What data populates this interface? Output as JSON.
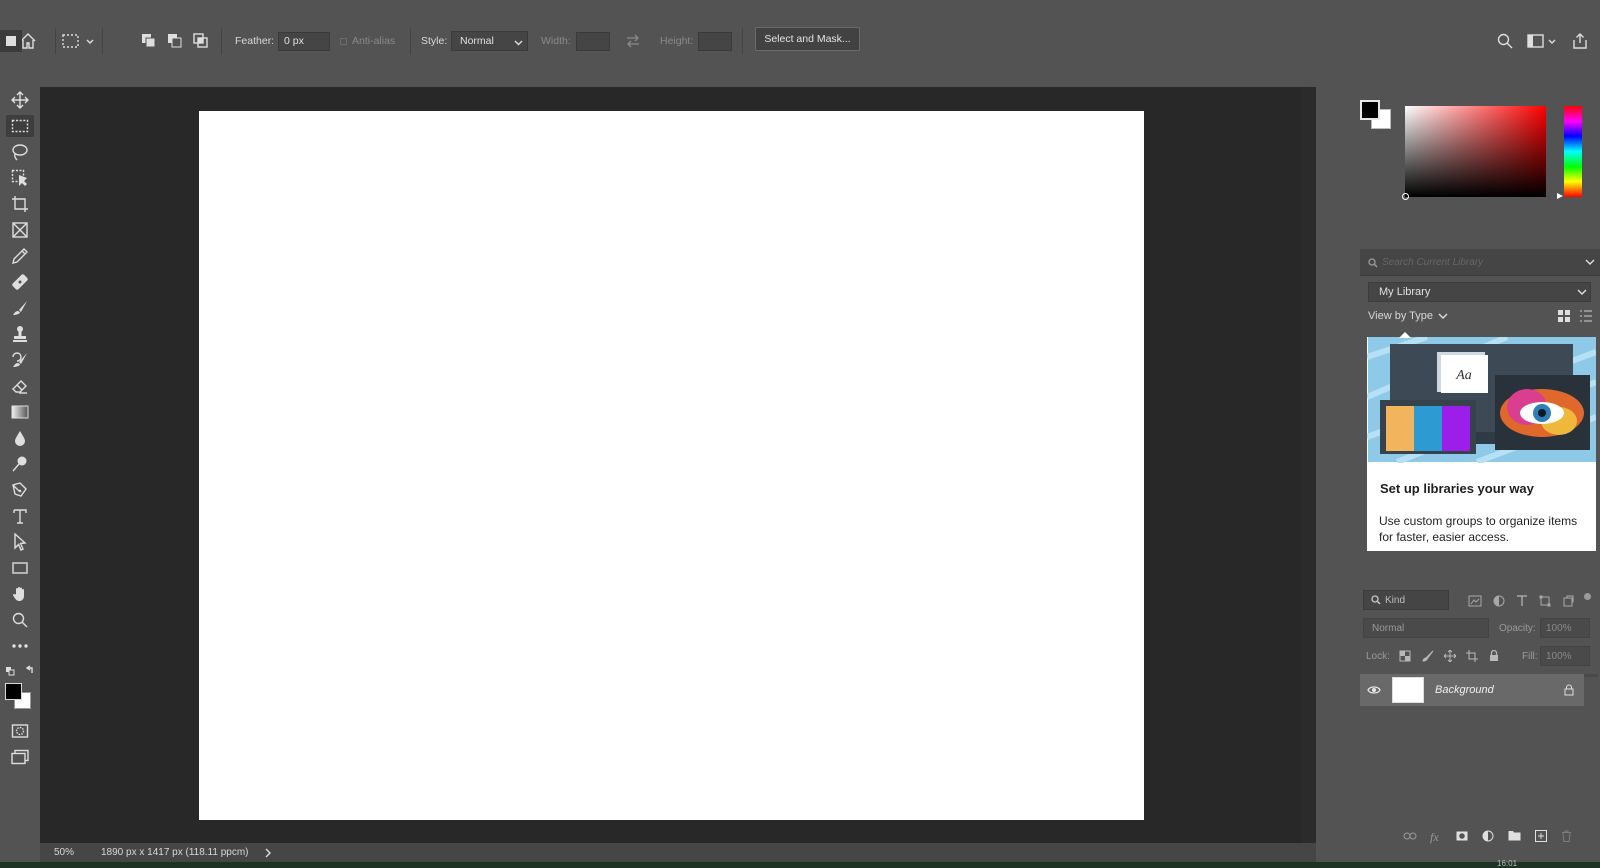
{
  "options_bar": {
    "feather_label": "Feather:",
    "feather_value": "0 px",
    "antialias_label": "Anti-alias",
    "style_label": "Style:",
    "style_value": "Normal",
    "width_label": "Width:",
    "height_label": "Height:",
    "select_mask_label": "Select and Mask..."
  },
  "toolbar": {
    "tools": [
      "move-tool",
      "marquee-tool",
      "lasso-tool",
      "object-selection-tool",
      "crop-tool",
      "frame-tool",
      "eyedropper-tool",
      "healing-brush-tool",
      "brush-tool",
      "clone-stamp-tool",
      "history-brush-tool",
      "eraser-tool",
      "gradient-tool",
      "blur-tool",
      "dodge-tool",
      "pen-tool",
      "type-tool",
      "path-selection-tool",
      "rectangle-tool",
      "hand-tool",
      "zoom-tool",
      "more-tools"
    ],
    "active_tool": "marquee-tool"
  },
  "document": {
    "background": "#ffffff"
  },
  "status": {
    "zoom": "50%",
    "doc_info": "1890 px x 1417 px (118.11 ppcm)"
  },
  "colors": {
    "foreground": "#000000",
    "background": "#ffffff",
    "picker_hue": "#ff0000"
  },
  "libraries": {
    "search_placeholder": "Search Current Library",
    "library_name": "My Library",
    "view_by": "View by Type",
    "card_title": "Set up libraries your way",
    "card_body": "Use custom groups to organize items for faster, easier access.",
    "card_glyph": "Aa"
  },
  "layers": {
    "filter_kind": "Kind",
    "blend_mode": "Normal",
    "opacity_label": "Opacity:",
    "opacity_value": "100%",
    "lock_label": "Lock:",
    "fill_label": "Fill:",
    "fill_value": "100%",
    "items": [
      {
        "name": "Background",
        "visible": true,
        "locked": true
      }
    ]
  },
  "taskbar": {
    "clock_fragment": "16:01"
  }
}
